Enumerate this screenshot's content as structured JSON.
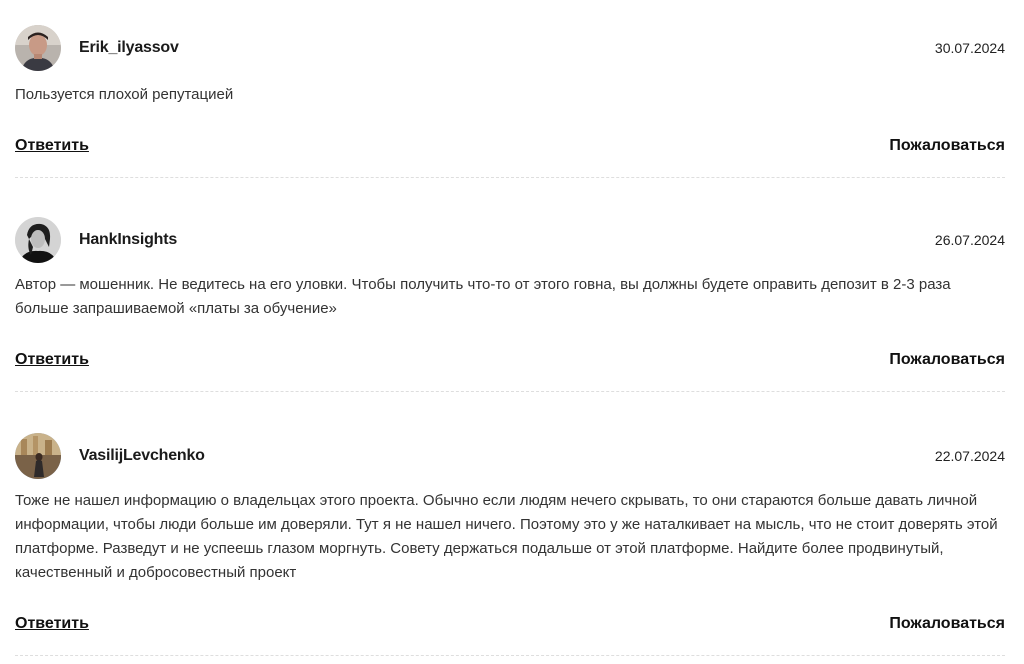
{
  "comments": [
    {
      "author": "Erik_ilyassov",
      "date": "30.07.2024",
      "text": "Пользуется плохой репутацией",
      "reply_label": "Ответить",
      "report_label": "Пожаловаться",
      "avatar_icon": "user-photo-avatar"
    },
    {
      "author": "HankInsights",
      "date": "26.07.2024",
      "text": "Автор — мошенник. Не ведитесь на его уловки. Чтобы получить что-то от этого говна, вы должны будете оправить депозит в 2-3 раза больше запрашиваемой «платы за обучение»",
      "reply_label": "Ответить",
      "report_label": "Пожаловаться",
      "avatar_icon": "user-photo-avatar"
    },
    {
      "author": "VasilijLevchenko",
      "date": "22.07.2024",
      "text": "Тоже не нашел информацию о владельцах этого проекта. Обычно если людям нечего скрывать, то они стараются больше давать личной информации, чтобы люди больше им доверяли. Тут я не нашел ничего. Поэтому это у же наталкивает на мысль, что не стоит доверять этой платформе. Разведут и не успеешь глазом моргнуть. Совету держаться подальше от этой платформе. Найдите более продвинутый, качественный и добросовестный проект",
      "reply_label": "Ответить",
      "report_label": "Пожаловаться",
      "avatar_icon": "user-photo-avatar"
    }
  ],
  "colors": {
    "text": "#333333",
    "heading": "#1b1b1b",
    "divider": "#dedede"
  }
}
